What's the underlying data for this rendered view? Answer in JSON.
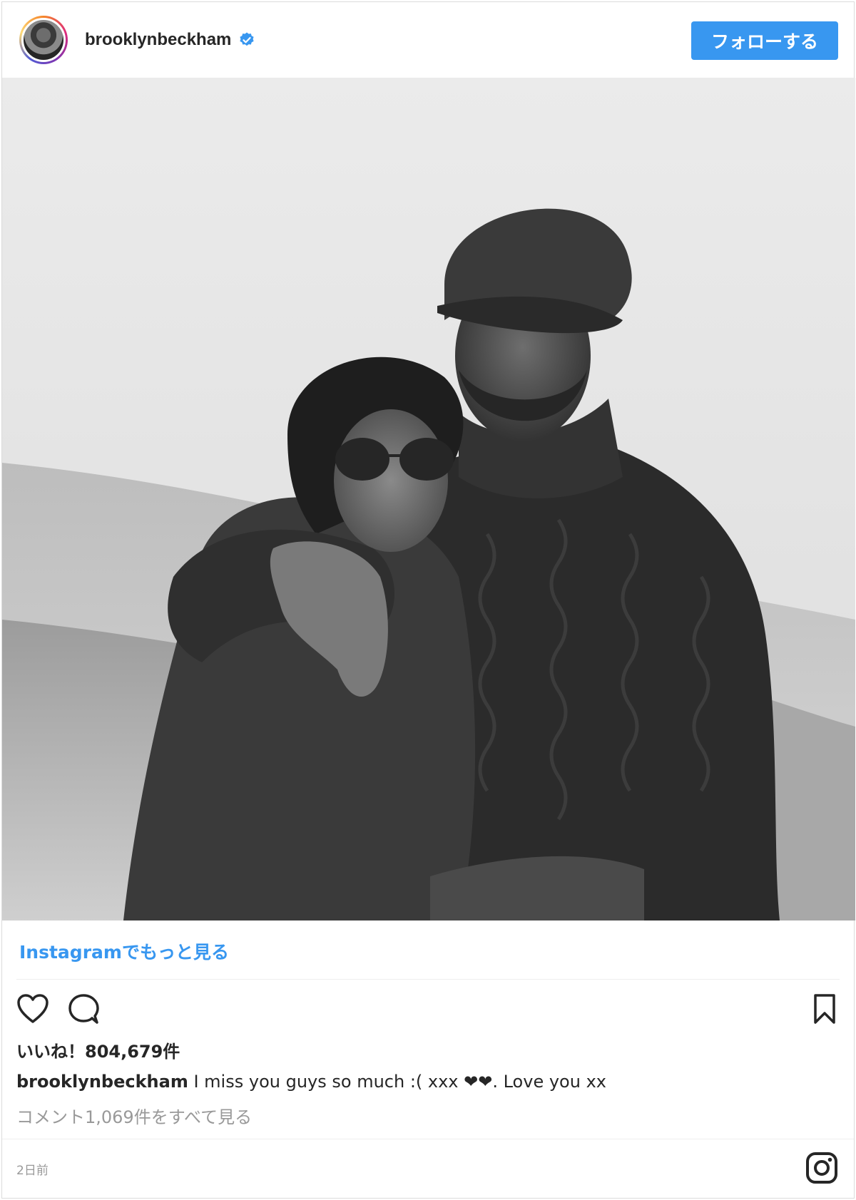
{
  "header": {
    "username": "brooklynbeckham",
    "verified": true,
    "follow_label": "フォローする"
  },
  "photo": {
    "style": "black-and-white",
    "subject": "couple-embracing-outdoors"
  },
  "more_link": "Instagramでもっと見る",
  "actions": {
    "like_icon": "heart-icon",
    "comment_icon": "comment-icon",
    "bookmark_icon": "bookmark-icon"
  },
  "likes_label": "いいね！804,679件",
  "caption": {
    "user": "brooklynbeckham",
    "text": " I miss you guys so much :( xxx ❤❤. Love you xx"
  },
  "view_comments": "コメント1,069件をすべて見る",
  "timestamp": "2日前",
  "colors": {
    "accent": "#3897f0",
    "text": "#262626",
    "muted": "#999999"
  }
}
